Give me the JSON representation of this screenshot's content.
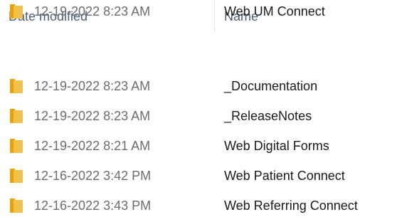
{
  "columns": {
    "date_modified": "Date modified",
    "name": "Name"
  },
  "colors": {
    "folder_yellow": "#f2c14a",
    "header_text": "#4c607a",
    "date_text": "#6d6d6d",
    "name_text": "#1a1a1a"
  },
  "rows": [
    {
      "icon": "folder-icon",
      "date": "12-19-2022 8:23 AM",
      "name": "_Documentation"
    },
    {
      "icon": "folder-icon",
      "date": "12-19-2022 8:23 AM",
      "name": "_ReleaseNotes"
    },
    {
      "icon": "folder-icon",
      "date": "12-19-2022 8:21 AM",
      "name": "Web Digital Forms"
    },
    {
      "icon": "folder-icon",
      "date": "12-16-2022 3:42 PM",
      "name": "Web Patient Connect"
    },
    {
      "icon": "folder-icon",
      "date": "12-16-2022 3:43 PM",
      "name": "Web Referring Connect"
    },
    {
      "icon": "folder-icon",
      "date": "12-19-2022 8:23 AM",
      "name": "Web UM Connect"
    }
  ]
}
